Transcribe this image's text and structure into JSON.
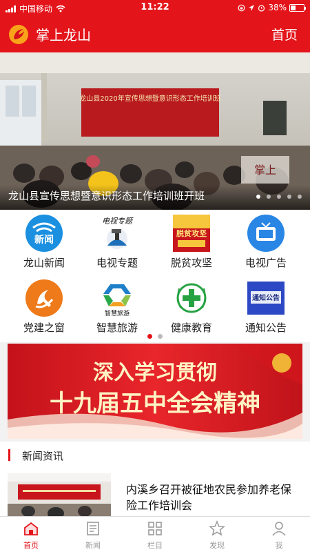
{
  "status": {
    "carrier": "中国移动",
    "time": "11:22",
    "battery": "38%"
  },
  "header": {
    "title": "掌上龙山",
    "home_label": "首页"
  },
  "banner": {
    "title": "龙山县宣传思想暨意识形态工作培训班开班",
    "dots": 5,
    "active_dot": 0,
    "slide_banner_text": "龙山县2020年宣传思想暨意识形态工作培训班",
    "watermark": "掌上"
  },
  "channels": [
    {
      "label": "龙山新闻",
      "icon": "news-icon",
      "icon_text": "新闻"
    },
    {
      "label": "电视专题",
      "icon": "tv-topic-icon",
      "icon_text": "电视专题"
    },
    {
      "label": "脱贫攻坚",
      "icon": "poverty-icon",
      "icon_text": "脱贫攻坚"
    },
    {
      "label": "电视广告",
      "icon": "tv-ad-icon"
    },
    {
      "label": "党建之窗",
      "icon": "party-icon"
    },
    {
      "label": "智慧旅游",
      "icon": "tourism-icon",
      "icon_text": "智慧旅游"
    },
    {
      "label": "健康教育",
      "icon": "health-icon"
    },
    {
      "label": "通知公告",
      "icon": "notice-icon",
      "icon_text": "通知公告"
    }
  ],
  "channel_pages": {
    "count": 2,
    "active": 0
  },
  "promo": {
    "line1": "深入学习贯彻",
    "line2": "十九届五中全会精神"
  },
  "section": {
    "title": "新闻资讯"
  },
  "news": [
    {
      "title": "内溪乡召开被征地农民参加养老保险工作培训会"
    }
  ],
  "tabs": [
    {
      "label": "首页",
      "icon": "home-icon",
      "active": true
    },
    {
      "label": "新闻",
      "icon": "news-list-icon",
      "active": false
    },
    {
      "label": "栏目",
      "icon": "grid-icon",
      "active": false
    },
    {
      "label": "发现",
      "icon": "discover-icon",
      "active": false
    },
    {
      "label": "我",
      "icon": "user-icon",
      "active": false
    }
  ],
  "colors": {
    "brand": "#e3141a",
    "tab_inactive": "#999999"
  }
}
